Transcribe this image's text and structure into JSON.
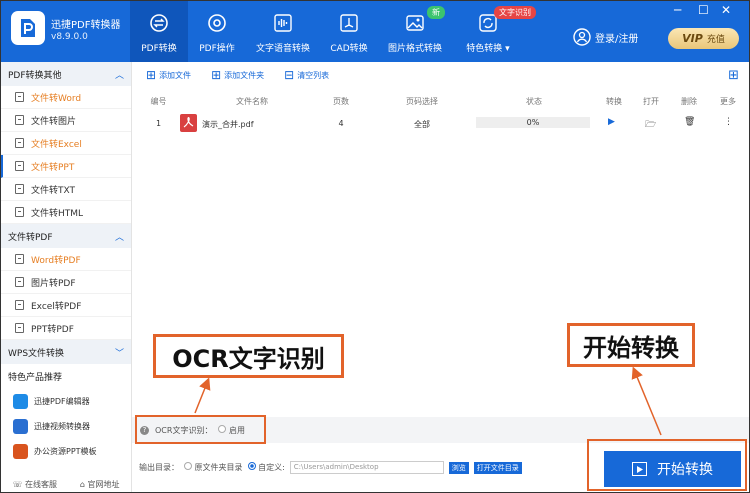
{
  "header": {
    "app_name": "迅捷PDF转换器",
    "version": "v8.9.0.0",
    "tabs": [
      {
        "label": "PDF转换",
        "icon": "convert-icon",
        "active": true
      },
      {
        "label": "PDF操作",
        "icon": "gear-icon"
      },
      {
        "label": "文字语音转换",
        "icon": "audio-wave-icon"
      },
      {
        "label": "CAD转换",
        "icon": "cad-icon"
      },
      {
        "label": "图片格式转换",
        "icon": "image-icon",
        "badge": "新"
      },
      {
        "label": "特色转换",
        "icon": "refresh-icon",
        "badge": "文字识别"
      }
    ],
    "login": "登录/注册",
    "vip_text": "VIP",
    "vip_label": "充值",
    "badge_new_color": "#3cc46e",
    "badge_ocr_color": "#e64545"
  },
  "sidebar": {
    "group1": "PDF转换其他",
    "group1_items": [
      "文件转Word",
      "文件转图片",
      "文件转Excel",
      "文件转PPT",
      "文件转TXT",
      "文件转HTML"
    ],
    "group2": "文件转PDF",
    "group2_items": [
      "Word转PDF",
      "图片转PDF",
      "Excel转PDF",
      "PPT转PDF"
    ],
    "group3": "WPS文件转换",
    "featured_title": "特色产品推荐",
    "products": [
      "迅捷PDF编辑器",
      "迅捷视频转换器",
      "办公资源PPT模板"
    ],
    "bottom": [
      "在线客服",
      "官网地址"
    ]
  },
  "toolbar": {
    "add_file": "添加文件",
    "add_folder": "添加文件夹",
    "clear_list": "清空列表"
  },
  "table": {
    "headers": [
      "编号",
      "文件名称",
      "页数",
      "页码选择",
      "状态",
      "转换",
      "打开",
      "删除",
      "更多"
    ],
    "row": {
      "index": "1",
      "name": "演示_合并.pdf",
      "pages": "4",
      "page_select": "全部",
      "status": "0%"
    }
  },
  "ocr": {
    "label": "OCR文字识别：",
    "option": "启用"
  },
  "output": {
    "label": "输出目录：",
    "opt1": "原文件夹目录",
    "opt2": "自定义:",
    "path": "C:\\Users\\admin\\Desktop",
    "browse": "浏览",
    "open_folder": "打开文件目录"
  },
  "start_button": "开始转换",
  "annotations": {
    "ocr_label": "OCR文字识别",
    "start_label": "开始转换",
    "color": "#e2632a"
  }
}
